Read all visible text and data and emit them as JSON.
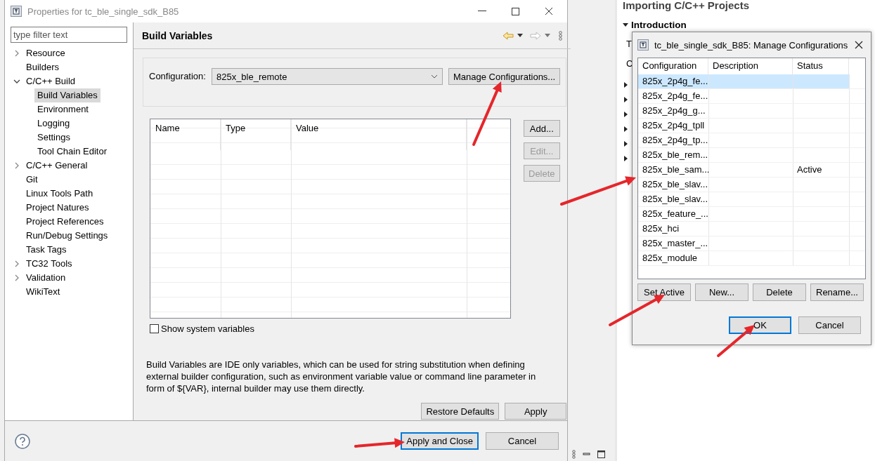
{
  "properties_window": {
    "title": "Properties for tc_ble_single_sdk_B85",
    "filter": {
      "placeholder": "type filter text"
    },
    "tree": [
      {
        "label": "Resource",
        "expanded": false,
        "selected": false
      },
      {
        "label": "Builders",
        "selected": false
      },
      {
        "label": "C/C++ Build",
        "expanded": true,
        "selected": false,
        "children": [
          {
            "label": "Build Variables",
            "selected": true
          },
          {
            "label": "Environment",
            "selected": false
          },
          {
            "label": "Logging",
            "selected": false
          },
          {
            "label": "Settings",
            "selected": false
          },
          {
            "label": "Tool Chain Editor",
            "selected": false
          }
        ]
      },
      {
        "label": "C/C++ General",
        "expanded": false,
        "selected": false
      },
      {
        "label": "Git",
        "selected": false
      },
      {
        "label": "Linux Tools Path",
        "selected": false
      },
      {
        "label": "Project Natures",
        "selected": false
      },
      {
        "label": "Project References",
        "selected": false
      },
      {
        "label": "Run/Debug Settings",
        "selected": false
      },
      {
        "label": "Task Tags",
        "selected": false
      },
      {
        "label": "TC32 Tools",
        "expanded": false,
        "selected": false
      },
      {
        "label": "Validation",
        "expanded": false,
        "selected": false
      },
      {
        "label": "WikiText",
        "selected": false
      }
    ],
    "page_title": "Build Variables",
    "configuration": {
      "label": "Configuration:",
      "value": "825x_ble_remote"
    },
    "manage_button": "Manage Configurations...",
    "table": {
      "columns": [
        "Name",
        "Type",
        "Value"
      ]
    },
    "side_buttons": [
      {
        "label": "Add...",
        "disabled": false
      },
      {
        "label": "Edit...",
        "disabled": true
      },
      {
        "label": "Delete",
        "disabled": true
      }
    ],
    "show_system": {
      "label": "Show system variables",
      "checked": false
    },
    "description": "Build Variables are IDE only variables, which can be used for string substitution when defining external builder configuration, such as environment variable value or command line parameter in form of ${VAR}, internal builder may use them directly.",
    "page_buttons": [
      "Restore Defaults",
      "Apply"
    ],
    "footer_buttons": [
      {
        "label": "Apply and Close",
        "default": true
      },
      {
        "label": "Cancel",
        "default": false
      }
    ]
  },
  "help_view": {
    "heading": "Importing C/C++ Projects",
    "section": "Introduction",
    "fragments": [
      "T",
      "C"
    ]
  },
  "manage_dialog": {
    "title": "tc_ble_single_sdk_B85: Manage Configurations",
    "columns": [
      "Configuration",
      "Description",
      "Status"
    ],
    "rows": [
      {
        "configuration": "825x_2p4g_fe...",
        "selected": true
      },
      {
        "configuration": "825x_2p4g_fe...",
        "selected": false
      },
      {
        "configuration": "825x_2p4g_g...",
        "selected": false
      },
      {
        "configuration": "825x_2p4g_tpll",
        "selected": false
      },
      {
        "configuration": "825x_2p4g_tp...",
        "selected": false
      },
      {
        "configuration": "825x_ble_rem...",
        "selected": false
      },
      {
        "configuration": "825x_ble_sam...",
        "status": "Active",
        "selected": false
      },
      {
        "configuration": "825x_ble_slav...",
        "selected": false
      },
      {
        "configuration": "825x_ble_slav...",
        "selected": false
      },
      {
        "configuration": "825x_feature_...",
        "selected": false
      },
      {
        "configuration": "825x_hci",
        "selected": false
      },
      {
        "configuration": "825x_master_...",
        "selected": false
      },
      {
        "configuration": "825x_module",
        "selected": false
      }
    ],
    "buttons": [
      "Set Active",
      "New...",
      "Delete",
      "Rename..."
    ],
    "footer_buttons": [
      {
        "label": "OK",
        "default": true
      },
      {
        "label": "Cancel",
        "default": false
      }
    ]
  }
}
